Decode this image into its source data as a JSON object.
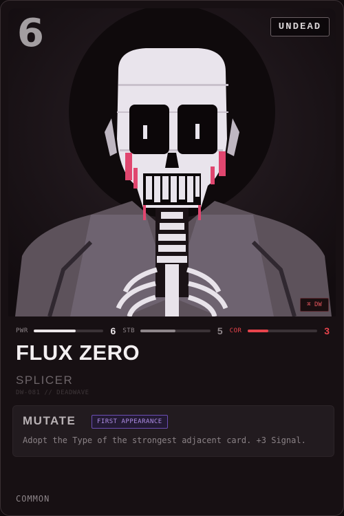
{
  "card": {
    "cost": "6",
    "type": "UNDEAD",
    "set_code": "⌘ DW",
    "name": "FLUX ZERO",
    "subtype": "SPLICER",
    "code": "DW-081 // DEADWAVE",
    "rarity": "COMMON"
  },
  "stats": [
    {
      "label": "PWR",
      "value": "6",
      "fill": 0.6,
      "color": "#ebe6e8"
    },
    {
      "label": "STB",
      "value": "5",
      "fill": 0.5,
      "color": "#8e868a"
    },
    {
      "label": "COR",
      "value": "3",
      "fill": 0.3,
      "color": "#e8444c"
    }
  ],
  "ability": {
    "name": "MUTATE",
    "tag": "FIRST APPEARANCE",
    "text": "Adopt the Type of the strongest adjacent card. +3 Signal."
  },
  "artwork": {
    "subject": "glitched skeleton portrait",
    "palette": [
      "#1b1418",
      "#6a5e68",
      "#e9e4ec",
      "#e0466f"
    ]
  }
}
